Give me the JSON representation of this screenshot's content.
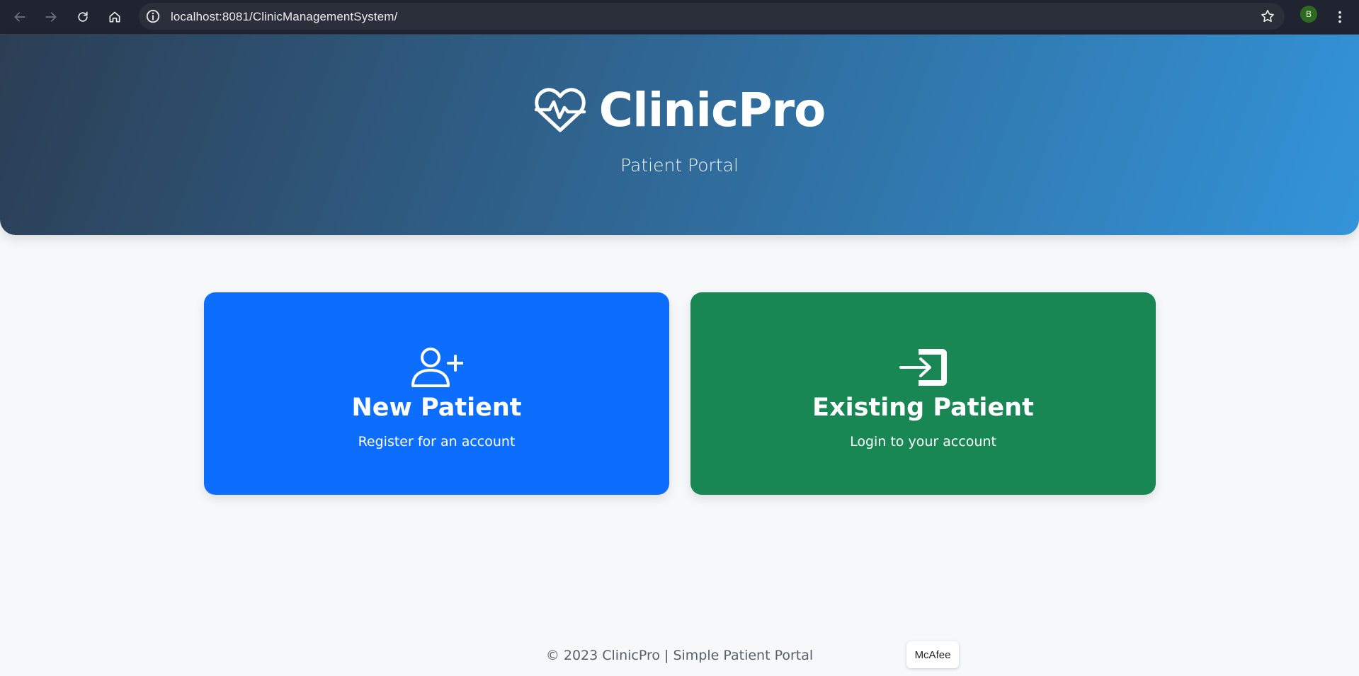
{
  "browser": {
    "url": "localhost:8081/ClinicManagementSystem/",
    "profile_initial": "B"
  },
  "hero": {
    "brand": "ClinicPro",
    "tagline": "Patient Portal",
    "gradient_start": "#2c3e54",
    "gradient_end": "#3394d9"
  },
  "cards": {
    "new_patient": {
      "icon": "person-plus-icon",
      "title": "New Patient",
      "subtitle": "Register for an account",
      "color": "#0d6efd"
    },
    "existing_patient": {
      "icon": "box-arrow-in-right-icon",
      "title": "Existing Patient",
      "subtitle": "Login to your account",
      "color": "#198754"
    }
  },
  "footer": {
    "text": "© 2023 ClinicPro | Simple Patient Portal"
  },
  "overlay": {
    "mcafee_label": "McAfee"
  }
}
